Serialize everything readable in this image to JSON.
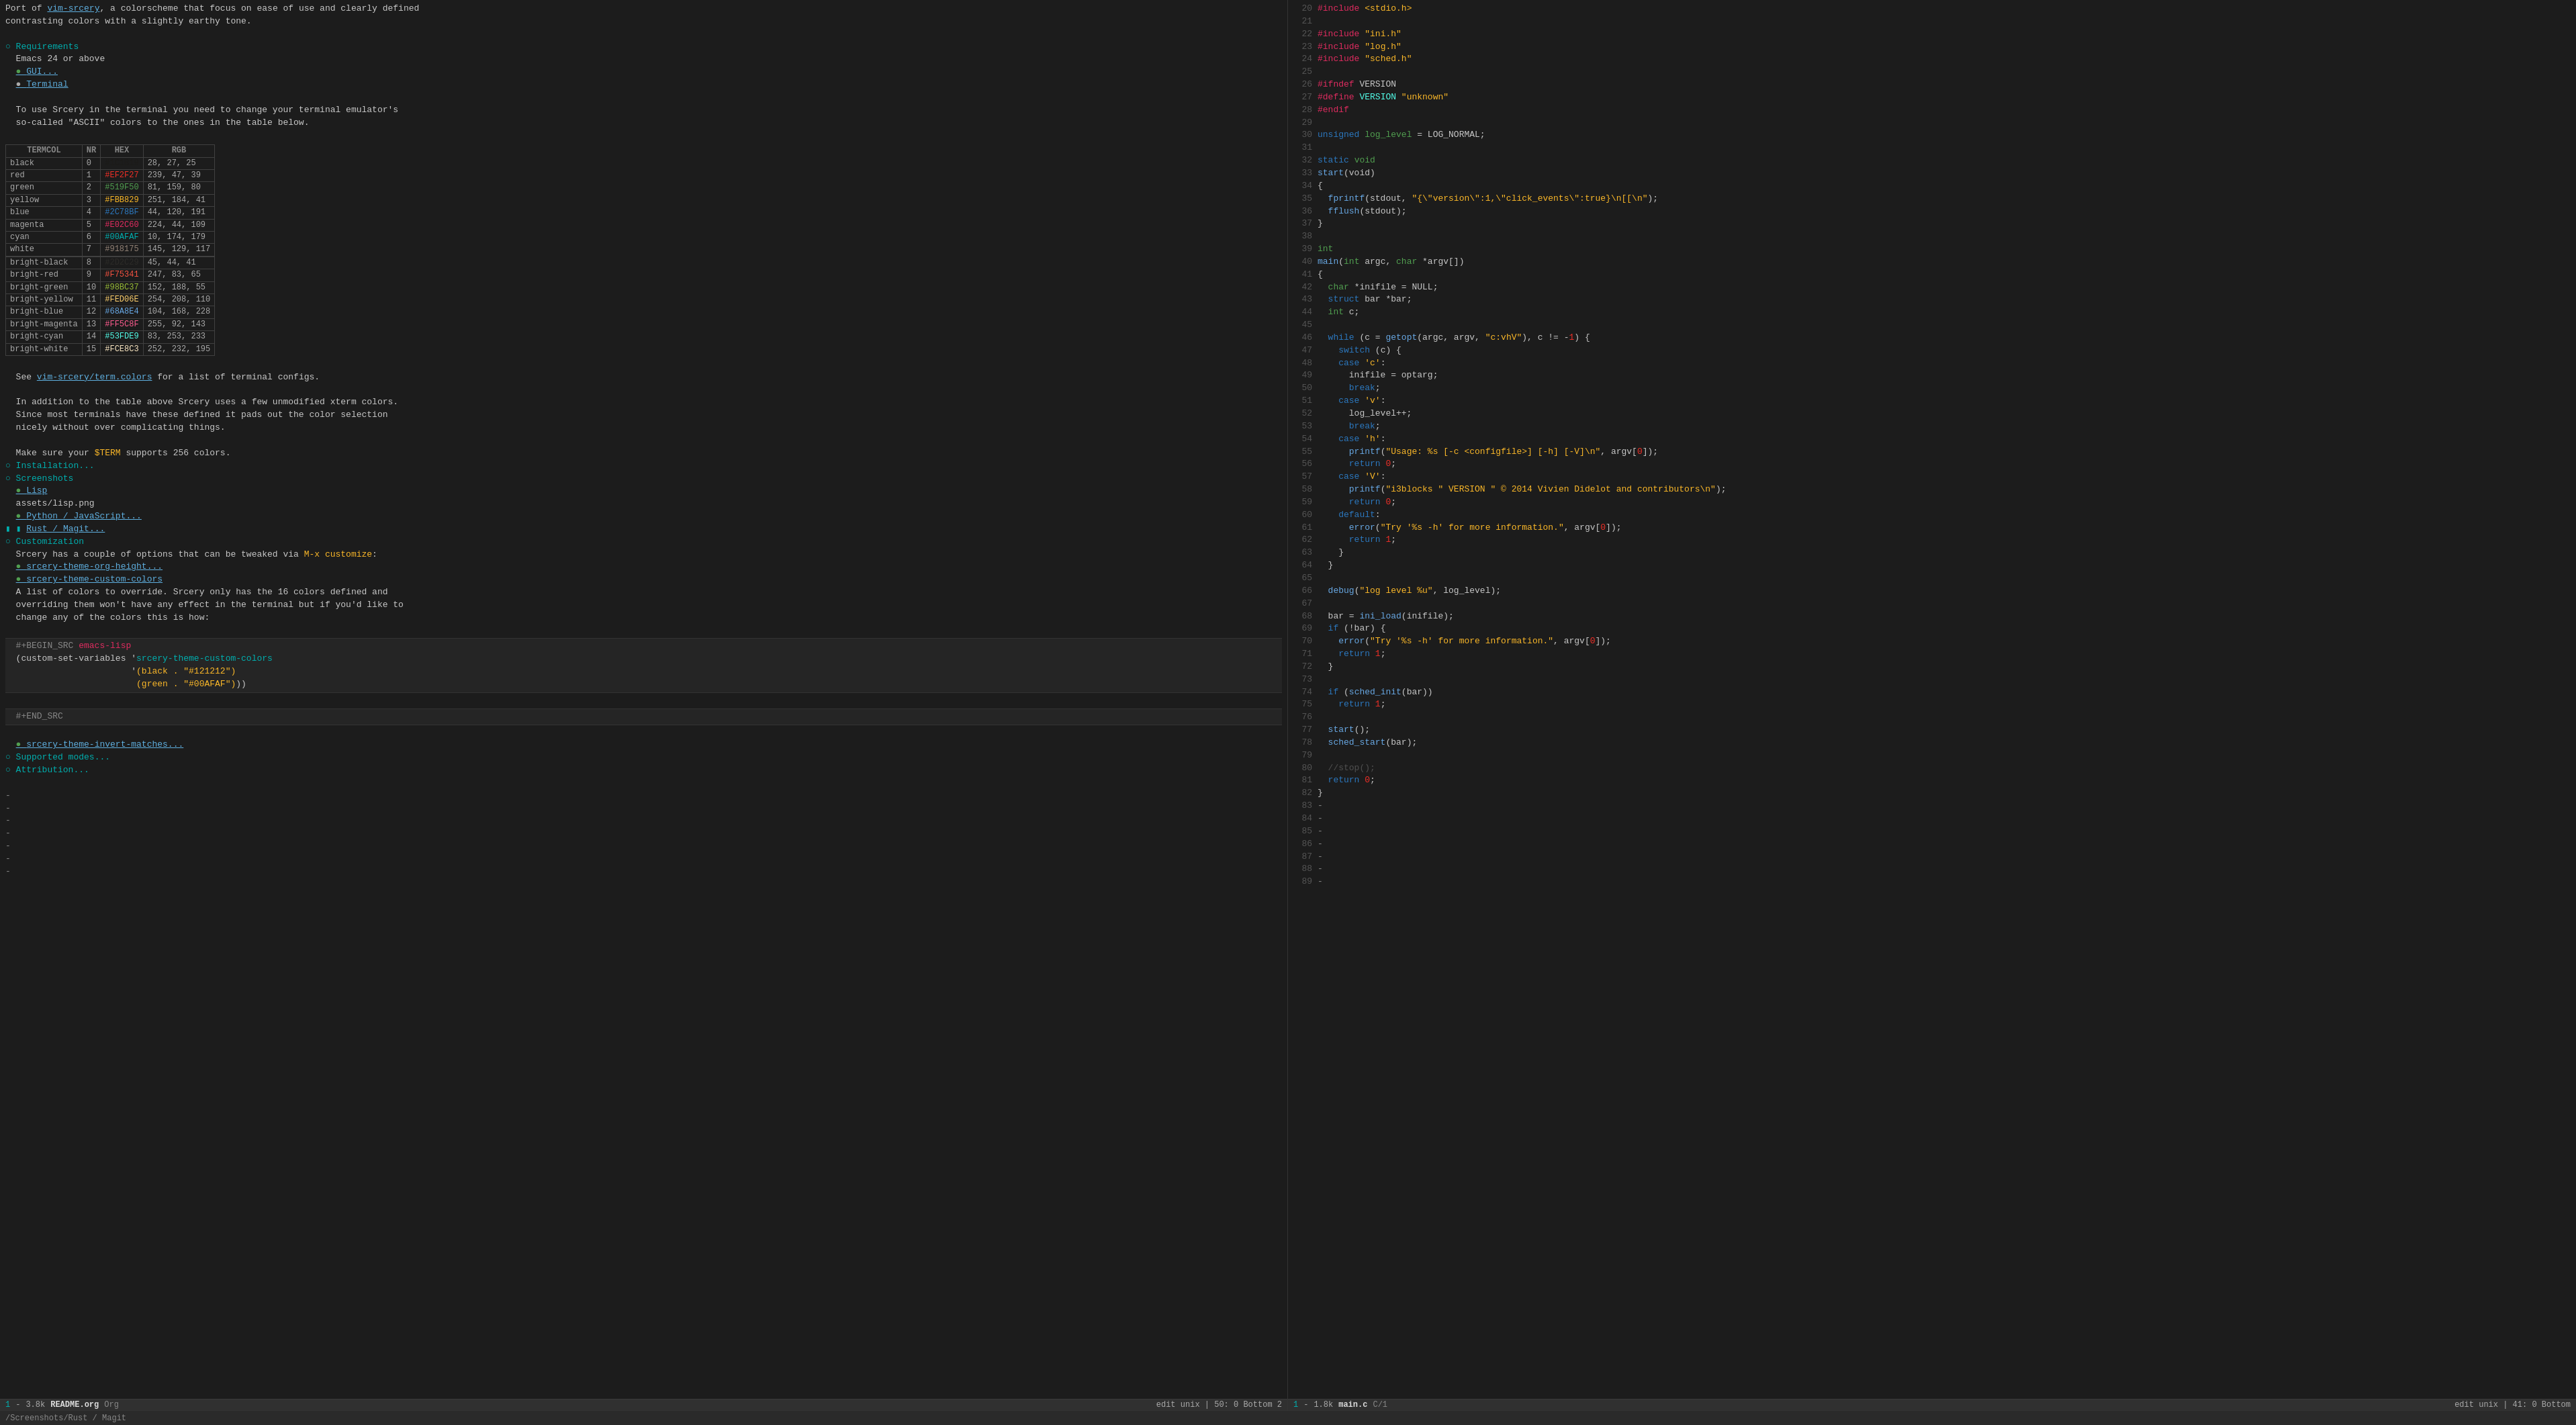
{
  "left_pane": {
    "content_lines": []
  },
  "right_pane": {
    "content_lines": []
  },
  "status_left_1": {
    "text": "1 - 3.8k  README.org  Org",
    "pos": "edit  unix | 50: 0  Bottom  2"
  },
  "status_left_2": {
    "text": "1.8k  main.c  C/1",
    "pos": "edit  unix | 41: 0  Bottom"
  },
  "minibuffer": {
    "text": "/Screenshots/Rust / Magit"
  }
}
